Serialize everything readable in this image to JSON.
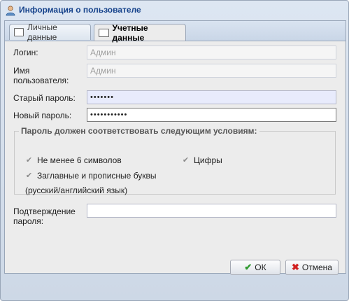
{
  "window": {
    "title": "Информация о пользователе"
  },
  "tabs": [
    {
      "label": "Личные данные",
      "active": false
    },
    {
      "label": "Учетные данные",
      "active": true
    }
  ],
  "form": {
    "login": {
      "label": "Логин:",
      "value": "Админ"
    },
    "username": {
      "label": "Имя пользователя:",
      "value": "Админ"
    },
    "old_password": {
      "label": "Старый пароль:",
      "value": "•••••••"
    },
    "new_password": {
      "label": "Новый пароль:",
      "value": "•••••••••••"
    },
    "rules": {
      "legend": "Пароль должен соответствовать следующим условиям:",
      "min_length": "Не менее 6 символов",
      "digits": "Цифры",
      "case": "Заглавные и прописные буквы",
      "case_note": "(русский/английский язык)"
    },
    "confirm": {
      "label": "Подтверждение пароля:",
      "value": ""
    }
  },
  "buttons": {
    "ok": "ОК",
    "cancel": "Отмена"
  },
  "colors": {
    "title": "#15428b",
    "ok_icon": "#2e9a2e",
    "cancel_icon": "#d12020"
  }
}
